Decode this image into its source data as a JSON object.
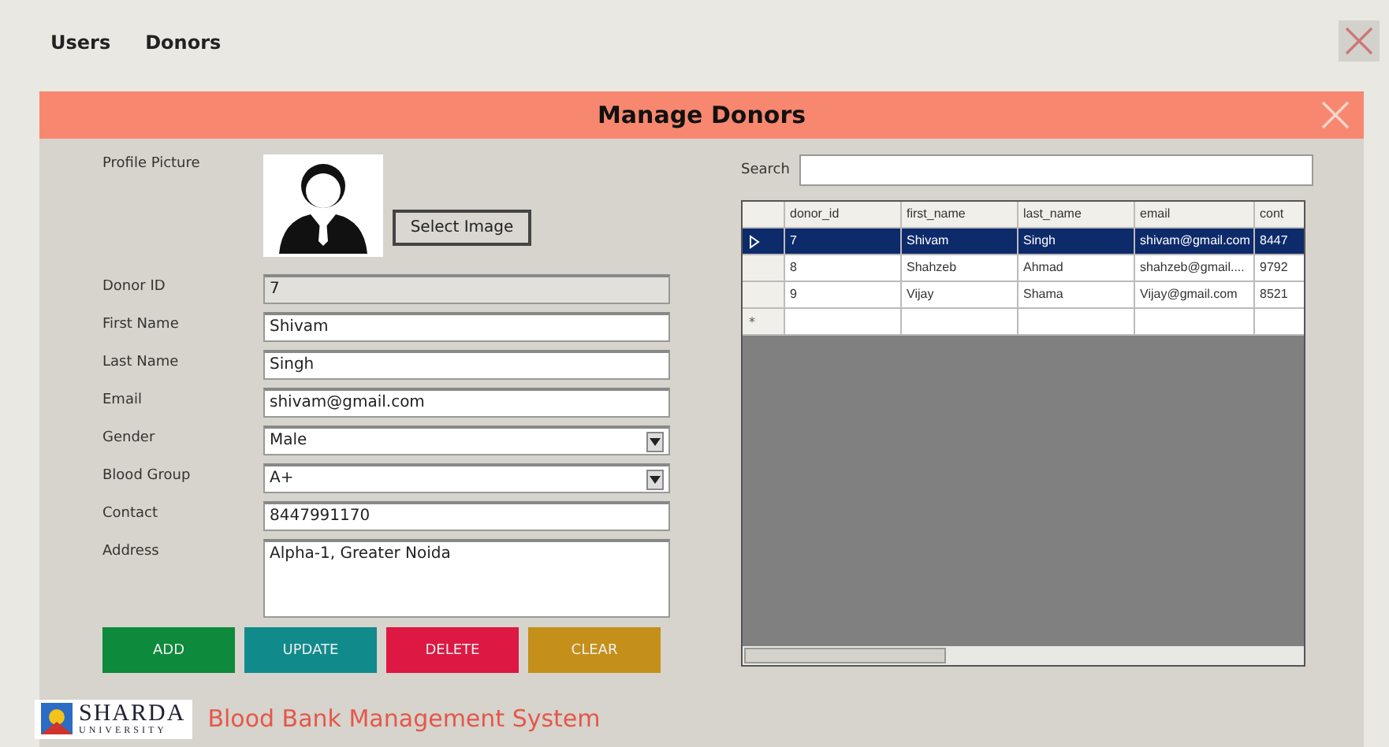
{
  "menu": [
    {
      "label": "Users"
    },
    {
      "label": "Donors"
    }
  ],
  "dialog": {
    "title": "Manage Donors"
  },
  "profile": {
    "label": "Profile Picture",
    "button": "Select Image"
  },
  "fields": [
    {
      "kind": "readonly",
      "label": "Donor ID",
      "value": "7"
    },
    {
      "kind": "text",
      "label": "First Name",
      "value": "Shivam"
    },
    {
      "kind": "text",
      "label": "Last Name",
      "value": "Singh"
    },
    {
      "kind": "text",
      "label": "Email",
      "value": "shivam@gmail.com"
    },
    {
      "kind": "select",
      "label": "Gender",
      "value": "Male"
    },
    {
      "kind": "select",
      "label": "Blood Group",
      "value": "A+"
    },
    {
      "kind": "text",
      "label": "Contact",
      "value": "8447991170"
    },
    {
      "kind": "textarea",
      "label": "Address",
      "value": "Alpha-1, Greater Noida"
    }
  ],
  "buttons": [
    {
      "label": "ADD",
      "color": "#0d8a3c"
    },
    {
      "label": "UPDATE",
      "color": "#118a8c"
    },
    {
      "label": "DELETE",
      "color": "#dc1843"
    },
    {
      "label": "CLEAR",
      "color": "#c4901a"
    }
  ],
  "search": {
    "label": "Search"
  },
  "table": {
    "columns": [
      "donor_id",
      "first_name",
      "last_name",
      "email",
      "cont"
    ],
    "rows": [
      {
        "selected": true,
        "cells": [
          "7",
          "Shivam",
          "Singh",
          "shivam@gmail.com",
          "8447"
        ]
      },
      {
        "selected": false,
        "cells": [
          "8",
          "Shahzeb",
          "Ahmad",
          "shahzeb@gmail....",
          "9792"
        ]
      },
      {
        "selected": false,
        "cells": [
          "9",
          "Vijay",
          "Shama",
          "Vijay@gmail.com",
          "8521"
        ]
      }
    ],
    "new_row_marker": "*"
  },
  "footer": {
    "logo_name": "SHARDA",
    "logo_sub": "UNIVERSITY",
    "title": "Blood Bank Management System"
  }
}
